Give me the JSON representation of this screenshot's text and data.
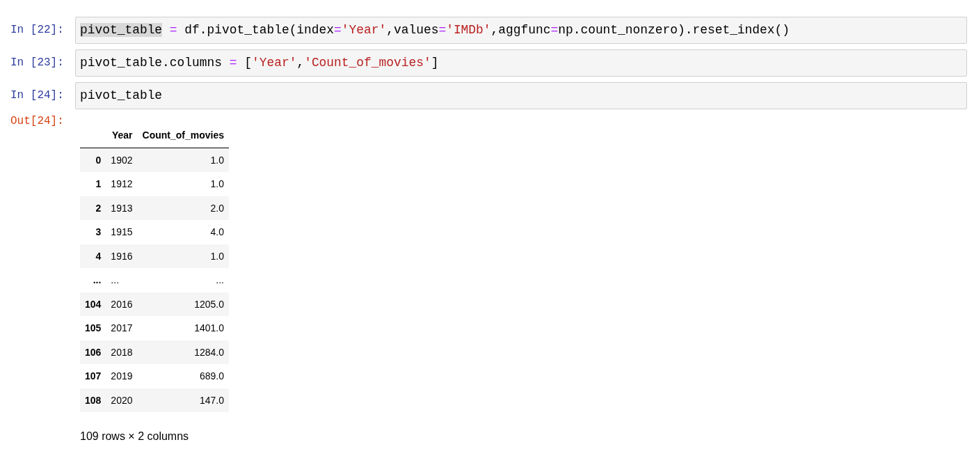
{
  "cells": [
    {
      "prompt": "In [22]:",
      "tokens": [
        {
          "kind": "match",
          "text": "pivot_table"
        },
        {
          "kind": "op",
          "text": " = "
        },
        {
          "kind": "text",
          "text": "df.pivot_table(index"
        },
        {
          "kind": "op",
          "text": "="
        },
        {
          "kind": "str",
          "text": "'Year'"
        },
        {
          "kind": "text",
          "text": ",values"
        },
        {
          "kind": "op",
          "text": "="
        },
        {
          "kind": "str",
          "text": "'IMDb'"
        },
        {
          "kind": "text",
          "text": ",aggfunc"
        },
        {
          "kind": "op",
          "text": "="
        },
        {
          "kind": "text",
          "text": "np.count_nonzero).reset_index()"
        }
      ]
    },
    {
      "prompt": "In [23]:",
      "tokens": [
        {
          "kind": "text",
          "text": "pivot_table.columns "
        },
        {
          "kind": "op",
          "text": "="
        },
        {
          "kind": "text",
          "text": " ["
        },
        {
          "kind": "str",
          "text": "'Year'"
        },
        {
          "kind": "text",
          "text": ","
        },
        {
          "kind": "str",
          "text": "'Count_of_movies'"
        },
        {
          "kind": "text",
          "text": "]"
        }
      ]
    },
    {
      "prompt": "In [24]:",
      "tokens": [
        {
          "kind": "text",
          "text": "pivot_table"
        }
      ]
    }
  ],
  "output": {
    "prompt": "Out[24]:",
    "table": {
      "columns": [
        "Year",
        "Count_of_movies"
      ],
      "rows": [
        {
          "index": "0",
          "cells": [
            "1902",
            "1.0"
          ]
        },
        {
          "index": "1",
          "cells": [
            "1912",
            "1.0"
          ]
        },
        {
          "index": "2",
          "cells": [
            "1913",
            "2.0"
          ]
        },
        {
          "index": "3",
          "cells": [
            "1915",
            "4.0"
          ]
        },
        {
          "index": "4",
          "cells": [
            "1916",
            "1.0"
          ]
        },
        {
          "index": "...",
          "cells": [
            "...",
            "..."
          ]
        },
        {
          "index": "104",
          "cells": [
            "2016",
            "1205.0"
          ]
        },
        {
          "index": "105",
          "cells": [
            "2017",
            "1401.0"
          ]
        },
        {
          "index": "106",
          "cells": [
            "2018",
            "1284.0"
          ]
        },
        {
          "index": "107",
          "cells": [
            "2019",
            "689.0"
          ]
        },
        {
          "index": "108",
          "cells": [
            "2020",
            "147.0"
          ]
        }
      ]
    },
    "footer": "109 rows × 2 columns"
  }
}
